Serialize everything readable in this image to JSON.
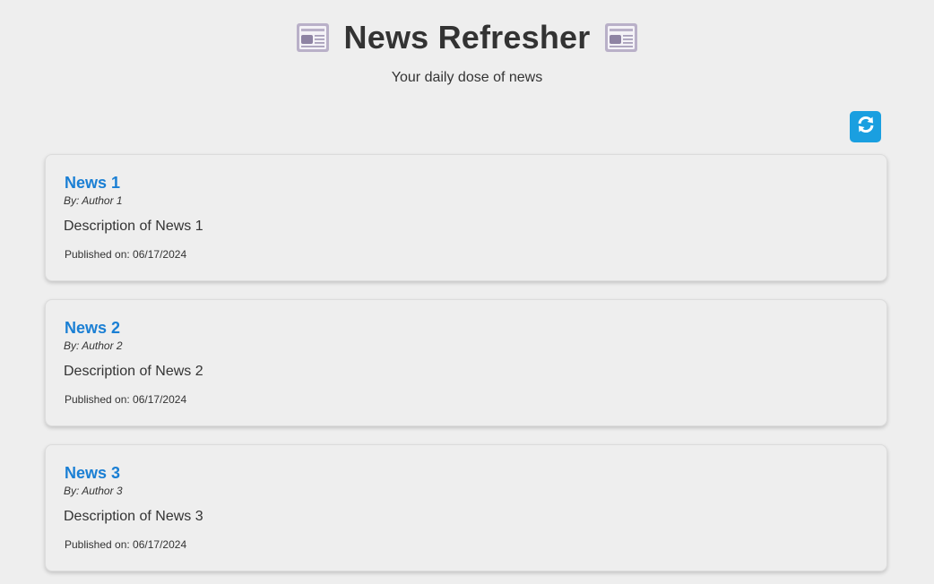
{
  "header": {
    "title": "News Refresher",
    "subtitle": "Your daily dose of news",
    "left_icon": "newspaper-icon",
    "right_icon": "newspaper-icon"
  },
  "toolbar": {
    "refresh_icon": "refresh-icon",
    "refresh_color": "#1a9fe0"
  },
  "articles": [
    {
      "title": "News 1",
      "author": "By: Author 1",
      "description": "Description of News 1",
      "published": "Published on: 06/17/2024"
    },
    {
      "title": "News 2",
      "author": "By: Author 2",
      "description": "Description of News 2",
      "published": "Published on: 06/17/2024"
    },
    {
      "title": "News 3",
      "author": "By: Author 3",
      "description": "Description of News 3",
      "published": "Published on: 06/17/2024"
    }
  ],
  "colors": {
    "background": "#eeeeee",
    "title_link": "#1a7fd4",
    "text": "#333333"
  }
}
